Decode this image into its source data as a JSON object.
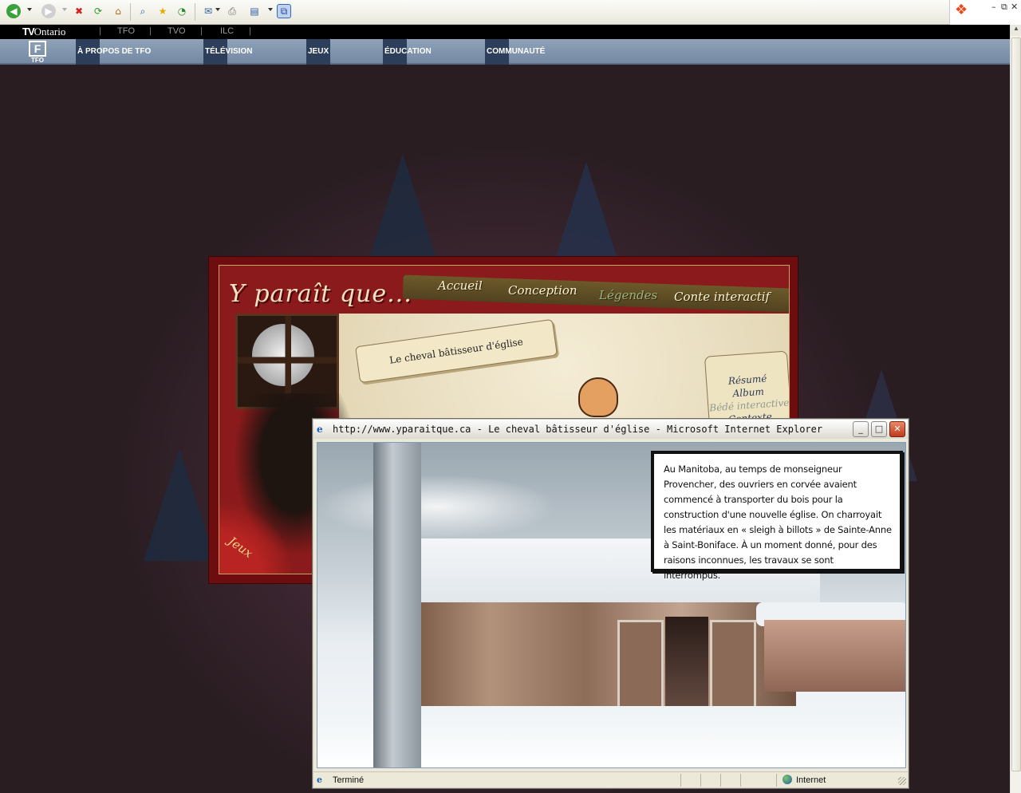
{
  "browser": {
    "toolbar_icons": [
      "back-icon",
      "forward-icon",
      "stop-icon",
      "refresh-icon",
      "home-icon",
      "search-icon",
      "favorites-icon",
      "history-icon",
      "mail-icon",
      "print-icon",
      "edit-icon",
      "messenger-icon"
    ]
  },
  "site_header": {
    "logo": "TVOntario",
    "logo_bold": "TV",
    "logo_rest": "Ontario",
    "top_links": [
      "TFO",
      "TVO",
      "ILC"
    ],
    "tfo_logo_label": "TFO",
    "nav": [
      "À PROPOS DE TFO",
      "TÉLÉVISION",
      "JEUX",
      "ÉDUCATION",
      "COMMUNAUTÉ"
    ]
  },
  "game": {
    "title": "Y paraît que...",
    "menu": [
      "Accueil",
      "Conception",
      "Légendes",
      "Conte interactif"
    ],
    "story_banner": "Le cheval bâtisseur d'église",
    "side_menu": [
      "Résumé",
      "Album",
      "Bédé interactive",
      "Contexte"
    ],
    "corner_label": "Jeux"
  },
  "popup": {
    "title": "http://www.yparaitque.ca - Le cheval bâtisseur d'église - Microsoft Internet Explorer",
    "story_text": "Au Manitoba, au temps de monseigneur Provencher, des ouvriers en corvée avaient commencé à transporter du bois pour la construction d'une nouvelle église. On charroyait les matériaux en « sleigh à billots » de Sainte-Anne à Saint-Boniface. À un moment donné, pour des raisons inconnues, les travaux se sont interrompus.",
    "status_text": "Terminé",
    "zone_text": "Internet",
    "minimize_glyph": "_",
    "maximize_glyph": "□",
    "close_glyph": "✕"
  },
  "colors": {
    "page_bg": "#2a1d22",
    "nav_bg": "#7f93ab",
    "nav_tab": "#2c3e59",
    "game_frame": "#6e0d10"
  }
}
